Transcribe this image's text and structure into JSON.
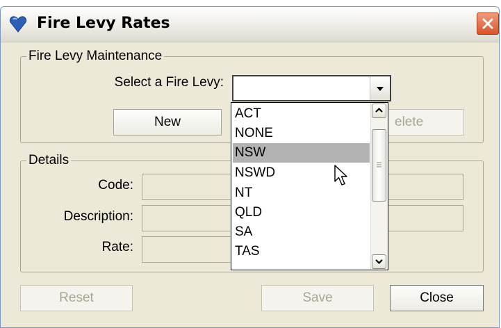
{
  "window": {
    "title": "Fire Levy Rates"
  },
  "maintenance": {
    "legend": "Fire Levy Maintenance",
    "select_label": "Select a Fire Levy:",
    "selected_value": "",
    "new_label": "New",
    "delete_label": "elete"
  },
  "dropdown": {
    "options": [
      "ACT",
      "NONE",
      "NSW",
      "NSWD",
      "NT",
      "QLD",
      "SA",
      "TAS"
    ],
    "highlighted": "NSW"
  },
  "details": {
    "legend": "Details",
    "code_label": "Code:",
    "description_label": "Description:",
    "rate_label": "Rate:"
  },
  "buttons": {
    "reset_label": "Reset",
    "save_label": "Save",
    "close_label": "Close"
  },
  "icons": {
    "app": "heart-icon",
    "close": "close-icon",
    "dropdown": "chevron-down-icon",
    "cursor": "pointer-cursor-icon"
  },
  "colors": {
    "app_icon": "#2e5fb5",
    "close_button": "#d8542b",
    "highlight": "#b3b3b3"
  }
}
